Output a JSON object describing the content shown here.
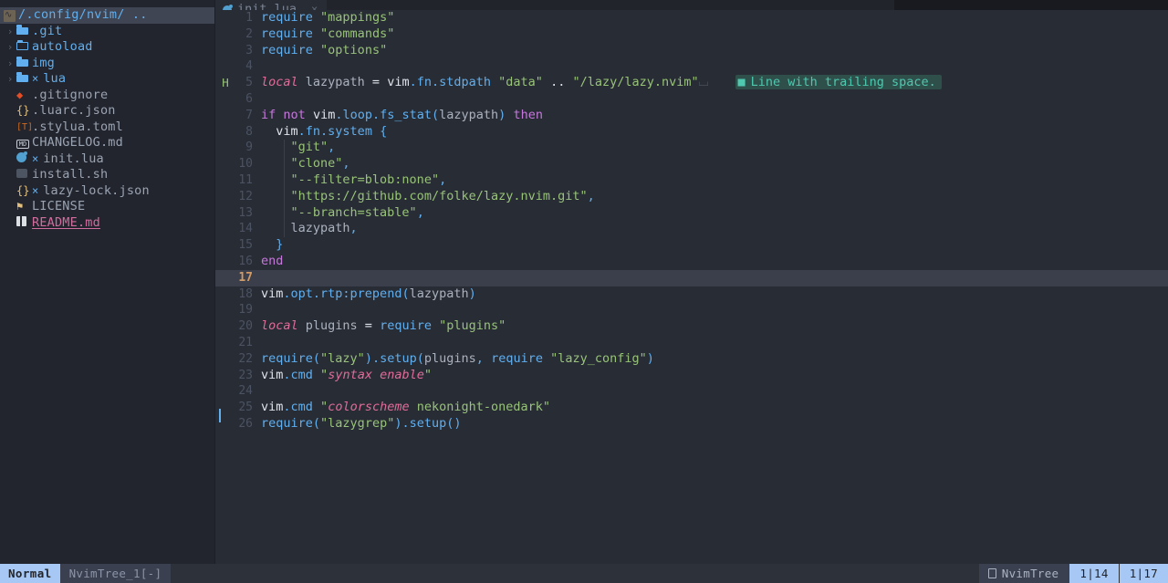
{
  "window": {
    "mode": "Normal"
  },
  "sidebar": {
    "root": {
      "icon": "neovim-icon",
      "label": "/.config/nvim/ .."
    },
    "items": [
      {
        "arrow": "›",
        "icon": "folder-icon",
        "name": ".git",
        "modified": false,
        "style": "dir"
      },
      {
        "arrow": "›",
        "icon": "folder-open-icon",
        "name": "autoload",
        "modified": false,
        "style": "dir"
      },
      {
        "arrow": "›",
        "icon": "folder-icon",
        "name": "img",
        "modified": false,
        "style": "dir"
      },
      {
        "arrow": "›",
        "icon": "folder-icon",
        "name": "lua",
        "modified": true,
        "style": "dir"
      },
      {
        "arrow": "",
        "icon": "git-icon",
        "name": ".gitignore",
        "modified": false,
        "style": "file"
      },
      {
        "arrow": "",
        "icon": "json-icon",
        "name": ".luarc.json",
        "modified": false,
        "style": "file"
      },
      {
        "arrow": "",
        "icon": "toml-icon",
        "name": ".stylua.toml",
        "modified": false,
        "style": "file"
      },
      {
        "arrow": "",
        "icon": "markdown-icon",
        "name": "CHANGELOG.md",
        "modified": false,
        "style": "file"
      },
      {
        "arrow": "",
        "icon": "lua-icon",
        "name": "init.lua",
        "modified": true,
        "style": "file"
      },
      {
        "arrow": "",
        "icon": "shell-icon",
        "name": "install.sh",
        "modified": false,
        "style": "file"
      },
      {
        "arrow": "",
        "icon": "json-icon",
        "name": "lazy-lock.json",
        "modified": true,
        "style": "file"
      },
      {
        "arrow": "",
        "icon": "license-icon",
        "name": "LICENSE",
        "modified": false,
        "style": "file"
      },
      {
        "arrow": "",
        "icon": "book-icon",
        "name": "README.md",
        "modified": false,
        "style": "opened"
      }
    ]
  },
  "tabs": [
    {
      "icon": "lua-icon",
      "label": "init.lua",
      "close": "×",
      "active": true
    }
  ],
  "diagnostic": {
    "sign": "H",
    "sign_line": 5,
    "message": "Line with trailing space.",
    "bullet": "■"
  },
  "editor": {
    "filename": "init.lua",
    "cursor_line": 17,
    "git_changed_line": 25,
    "lines": [
      {
        "n": 1,
        "tokens": [
          {
            "t": "require",
            "c": "t-fn"
          },
          {
            "t": " ",
            "c": "t-id"
          },
          {
            "t": "\"mappings\"",
            "c": "t-str"
          }
        ]
      },
      {
        "n": 2,
        "tokens": [
          {
            "t": "require",
            "c": "t-fn"
          },
          {
            "t": " ",
            "c": "t-id"
          },
          {
            "t": "\"commands\"",
            "c": "t-str"
          }
        ]
      },
      {
        "n": 3,
        "tokens": [
          {
            "t": "require",
            "c": "t-fn"
          },
          {
            "t": " ",
            "c": "t-id"
          },
          {
            "t": "\"options\"",
            "c": "t-str"
          }
        ]
      },
      {
        "n": 4,
        "tokens": []
      },
      {
        "n": 5,
        "tokens": [
          {
            "t": "local",
            "c": "t-kw-it"
          },
          {
            "t": " lazypath ",
            "c": "t-id"
          },
          {
            "t": "=",
            "c": "t-white"
          },
          {
            "t": " ",
            "c": "t-id"
          },
          {
            "t": "vim",
            "c": "t-white"
          },
          {
            "t": ".fn",
            "c": "t-blue"
          },
          {
            "t": ".stdpath",
            "c": "t-blue"
          },
          {
            "t": " ",
            "c": "t-id"
          },
          {
            "t": "\"data\"",
            "c": "t-str"
          },
          {
            "t": " ",
            "c": "t-id"
          },
          {
            "t": "..",
            "c": "t-white"
          },
          {
            "t": " ",
            "c": "t-id"
          },
          {
            "t": "\"/lazy/lazy.nvim\"",
            "c": "t-str"
          }
        ]
      },
      {
        "n": 6,
        "tokens": []
      },
      {
        "n": 7,
        "tokens": [
          {
            "t": "if",
            "c": "t-kw"
          },
          {
            "t": " ",
            "c": "t-id"
          },
          {
            "t": "not",
            "c": "t-kw"
          },
          {
            "t": " ",
            "c": "t-id"
          },
          {
            "t": "vim",
            "c": "t-white"
          },
          {
            "t": ".loop",
            "c": "t-blue"
          },
          {
            "t": ".fs_stat",
            "c": "t-blue"
          },
          {
            "t": "(",
            "c": "t-punc"
          },
          {
            "t": "lazypath",
            "c": "t-id"
          },
          {
            "t": ")",
            "c": "t-punc"
          },
          {
            "t": " ",
            "c": "t-id"
          },
          {
            "t": "then",
            "c": "t-kw"
          }
        ]
      },
      {
        "n": 8,
        "tokens": [
          {
            "t": "  ",
            "c": "t-id"
          },
          {
            "t": "vim",
            "c": "t-white"
          },
          {
            "t": ".fn",
            "c": "t-blue"
          },
          {
            "t": ".system",
            "c": "t-blue"
          },
          {
            "t": " ",
            "c": "t-id"
          },
          {
            "t": "{",
            "c": "t-punc"
          }
        ]
      },
      {
        "n": 9,
        "tokens": [
          {
            "t": "    ",
            "c": "t-id"
          },
          {
            "t": "\"git\"",
            "c": "t-str"
          },
          {
            "t": ",",
            "c": "t-punc"
          }
        ]
      },
      {
        "n": 10,
        "tokens": [
          {
            "t": "    ",
            "c": "t-id"
          },
          {
            "t": "\"clone\"",
            "c": "t-str"
          },
          {
            "t": ",",
            "c": "t-punc"
          }
        ]
      },
      {
        "n": 11,
        "tokens": [
          {
            "t": "    ",
            "c": "t-id"
          },
          {
            "t": "\"--filter=blob:none\"",
            "c": "t-str"
          },
          {
            "t": ",",
            "c": "t-punc"
          }
        ]
      },
      {
        "n": 12,
        "tokens": [
          {
            "t": "    ",
            "c": "t-id"
          },
          {
            "t": "\"https://github.com/folke/lazy.nvim.git\"",
            "c": "t-str"
          },
          {
            "t": ",",
            "c": "t-punc"
          }
        ]
      },
      {
        "n": 13,
        "tokens": [
          {
            "t": "    ",
            "c": "t-id"
          },
          {
            "t": "\"--branch=stable\"",
            "c": "t-str"
          },
          {
            "t": ",",
            "c": "t-punc"
          }
        ]
      },
      {
        "n": 14,
        "tokens": [
          {
            "t": "    ",
            "c": "t-id"
          },
          {
            "t": "lazypath",
            "c": "t-id"
          },
          {
            "t": ",",
            "c": "t-punc"
          }
        ]
      },
      {
        "n": 15,
        "tokens": [
          {
            "t": "  ",
            "c": "t-id"
          },
          {
            "t": "}",
            "c": "t-punc"
          }
        ]
      },
      {
        "n": 16,
        "tokens": [
          {
            "t": "end",
            "c": "t-kw"
          }
        ]
      },
      {
        "n": 17,
        "tokens": []
      },
      {
        "n": 18,
        "tokens": [
          {
            "t": "vim",
            "c": "t-white"
          },
          {
            "t": ".opt",
            "c": "t-blue"
          },
          {
            "t": ".rtp",
            "c": "t-blue"
          },
          {
            "t": ":prepend",
            "c": "t-blue"
          },
          {
            "t": "(",
            "c": "t-punc"
          },
          {
            "t": "lazypath",
            "c": "t-id"
          },
          {
            "t": ")",
            "c": "t-punc"
          }
        ]
      },
      {
        "n": 19,
        "tokens": []
      },
      {
        "n": 20,
        "tokens": [
          {
            "t": "local",
            "c": "t-kw-it"
          },
          {
            "t": " plugins ",
            "c": "t-id"
          },
          {
            "t": "=",
            "c": "t-white"
          },
          {
            "t": " ",
            "c": "t-id"
          },
          {
            "t": "require",
            "c": "t-fn"
          },
          {
            "t": " ",
            "c": "t-id"
          },
          {
            "t": "\"plugins\"",
            "c": "t-str"
          }
        ]
      },
      {
        "n": 21,
        "tokens": []
      },
      {
        "n": 22,
        "tokens": [
          {
            "t": "require",
            "c": "t-fn"
          },
          {
            "t": "(",
            "c": "t-punc"
          },
          {
            "t": "\"lazy\"",
            "c": "t-str"
          },
          {
            "t": ")",
            "c": "t-punc"
          },
          {
            "t": ".setup",
            "c": "t-blue"
          },
          {
            "t": "(",
            "c": "t-punc"
          },
          {
            "t": "plugins",
            "c": "t-id"
          },
          {
            "t": ",",
            "c": "t-punc"
          },
          {
            "t": " ",
            "c": "t-id"
          },
          {
            "t": "require",
            "c": "t-fn"
          },
          {
            "t": " ",
            "c": "t-id"
          },
          {
            "t": "\"lazy_config\"",
            "c": "t-str"
          },
          {
            "t": ")",
            "c": "t-punc"
          }
        ]
      },
      {
        "n": 23,
        "tokens": [
          {
            "t": "vim",
            "c": "t-white"
          },
          {
            "t": ".cmd",
            "c": "t-blue"
          },
          {
            "t": " ",
            "c": "t-id"
          },
          {
            "t": "\"",
            "c": "t-str"
          },
          {
            "t": "syntax enable",
            "c": "t-pink-it"
          },
          {
            "t": "\"",
            "c": "t-str"
          }
        ]
      },
      {
        "n": 24,
        "tokens": []
      },
      {
        "n": 25,
        "tokens": [
          {
            "t": "vim",
            "c": "t-white"
          },
          {
            "t": ".cmd",
            "c": "t-blue"
          },
          {
            "t": " ",
            "c": "t-id"
          },
          {
            "t": "\"",
            "c": "t-str"
          },
          {
            "t": "colorscheme",
            "c": "t-pink-it"
          },
          {
            "t": " nekonight-onedark",
            "c": "t-str"
          },
          {
            "t": "\"",
            "c": "t-str"
          }
        ]
      },
      {
        "n": 26,
        "tokens": [
          {
            "t": "require",
            "c": "t-fn"
          },
          {
            "t": "(",
            "c": "t-punc"
          },
          {
            "t": "\"lazygrep\"",
            "c": "t-str"
          },
          {
            "t": ")",
            "c": "t-punc"
          },
          {
            "t": ".setup",
            "c": "t-blue"
          },
          {
            "t": "(",
            "c": "t-punc"
          },
          {
            "t": ")",
            "c": "t-punc"
          }
        ]
      }
    ]
  },
  "statusline": {
    "mode": "Normal",
    "buffer": "NvimTree_1[-]",
    "filetype": "NvimTree",
    "position_left": "1|14",
    "position_right": "1|17"
  },
  "colors": {
    "bg_editor": "#282c34",
    "bg_sidebar": "#22252d",
    "accent_blue": "#61afef",
    "string_green": "#98c379",
    "keyword_purple": "#c678dd",
    "cursorline": "#3a3f4b",
    "statusline_accent": "#a7c8f5"
  }
}
